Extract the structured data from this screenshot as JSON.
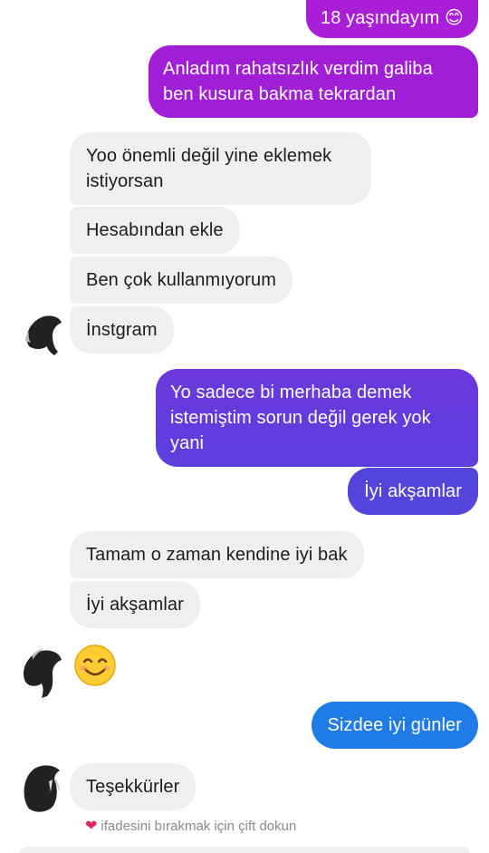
{
  "colors": {
    "incoming_bubble": "#efefef",
    "outgoing_gradient_top": "#b018d6",
    "outgoing_gradient_mid": "#6a35d8",
    "outgoing_gradient_bottom": "#1f7be6",
    "heart": "#e0245e"
  },
  "messages": {
    "m1": "18 yaşındayım 😊",
    "m2": "Anladım rahatsızlık verdim galiba\nben kusura bakma tekrardan",
    "m3": "Yoo önemli değil yine eklemek\nistiyorsan",
    "m4": "Hesabından ekle",
    "m5": "Ben çok kullanmıyorum",
    "m6": "İnstgram",
    "m7": "Yo sadece bi merhaba demek\nistemiştim sorun değil gerek yok\nyani",
    "m8": "İyi akşamlar",
    "m9": "Tamam o zaman kendine iyi bak",
    "m10": "İyi akşamlar",
    "m11": "Sizdee iyi günler",
    "m12": "Teşekkürler"
  },
  "reaction_hint": {
    "icon": "heart-icon",
    "text": "ifadesini bırakmak için çift dokun"
  }
}
